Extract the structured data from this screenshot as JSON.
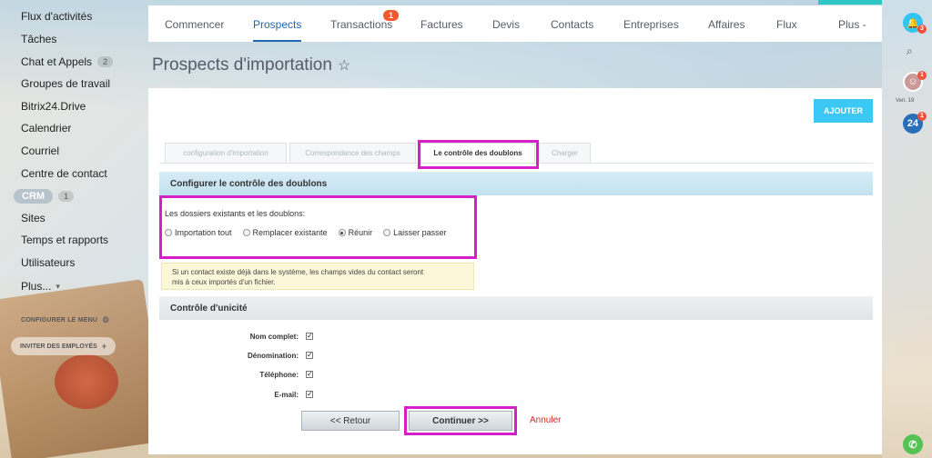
{
  "sidebar": {
    "items": [
      {
        "label": "Flux d'activités"
      },
      {
        "label": "Tâches"
      },
      {
        "label": "Chat et Appels",
        "badge": "2"
      },
      {
        "label": "Groupes de travail"
      },
      {
        "label": "Bitrix24.Drive"
      },
      {
        "label": "Calendrier"
      },
      {
        "label": "Courriel"
      },
      {
        "label": "Centre de contact"
      },
      {
        "label": "CRM",
        "badge": "1"
      },
      {
        "label": "Sites"
      },
      {
        "label": "Temps et rapports"
      },
      {
        "label": "Utilisateurs"
      },
      {
        "label": "Plus..."
      }
    ],
    "configure_menu": "CONFIGURER LE MENU",
    "invite": "INVITER DES EMPLOYÉS"
  },
  "topnav": {
    "items": [
      "Commencer",
      "Prospects",
      "Transactions",
      "Factures",
      "Devis",
      "Contacts",
      "Entreprises",
      "Affaires",
      "Flux",
      "Plus -"
    ],
    "transactions_count": "1"
  },
  "page": {
    "title": "Prospects d'importation",
    "add_button": "AJOUTER"
  },
  "tabs": [
    "configuration d'importation",
    "Correspondance des champs",
    "Le contrôle des doublons",
    "Charger"
  ],
  "duplicates": {
    "header": "Configurer le contrôle des doublons",
    "label": "Les dossiers existants et les doublons:",
    "options": [
      "Importation tout",
      "Remplacer existante",
      "Réunir",
      "Laisser passer"
    ],
    "selected": "Réunir",
    "note_line1": "Si un contact existe déjà dans le système, les champs vides du contact seront",
    "note_line2": "mis à ceux importés d'un fichier."
  },
  "uniqueness": {
    "header": "Contrôle d'unicité",
    "fields": [
      "Nom complet:",
      "Dénomination:",
      "Téléphone:",
      "E-mail:"
    ]
  },
  "actions": {
    "back": "<< Retour",
    "next": "Continuer >>",
    "cancel": "Annuler"
  },
  "right_bar": {
    "notif_count": "3",
    "avatar_count": "1",
    "day": "Ven. 19",
    "b24_count": "1",
    "b24_label": "24"
  },
  "colors": {
    "accent": "#2067b0",
    "add_button": "#3bc8f5",
    "highlight": "#d61fc9",
    "cancel": "#d12b2b"
  }
}
